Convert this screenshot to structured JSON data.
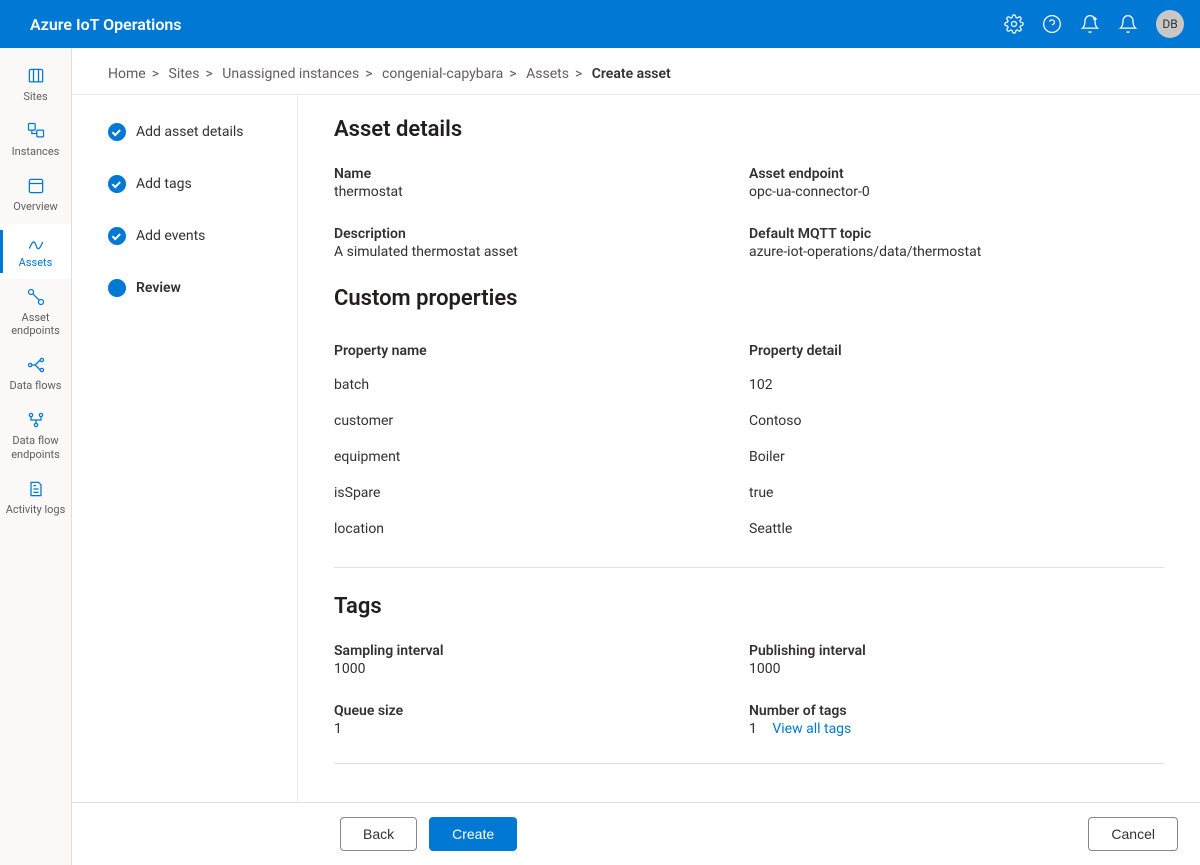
{
  "header": {
    "brand": "Azure IoT Operations",
    "avatar_initials": "DB"
  },
  "sidenav": {
    "items": [
      {
        "label": "Sites"
      },
      {
        "label": "Instances"
      },
      {
        "label": "Overview"
      },
      {
        "label": "Assets"
      },
      {
        "label": "Asset endpoints"
      },
      {
        "label": "Data flows"
      },
      {
        "label": "Data flow endpoints"
      },
      {
        "label": "Activity logs"
      }
    ]
  },
  "breadcrumb": {
    "items": [
      {
        "label": "Home"
      },
      {
        "label": "Sites"
      },
      {
        "label": "Unassigned instances"
      },
      {
        "label": "congenial-capybara"
      },
      {
        "label": "Assets"
      }
    ],
    "current": "Create asset"
  },
  "steps": [
    {
      "label": "Add asset details",
      "done": true
    },
    {
      "label": "Add tags",
      "done": true
    },
    {
      "label": "Add events",
      "done": true
    },
    {
      "label": "Review",
      "current": true
    }
  ],
  "sections": {
    "asset_details": {
      "title": "Asset details",
      "name_label": "Name",
      "name_value": "thermostat",
      "endpoint_label": "Asset endpoint",
      "endpoint_value": "opc-ua-connector-0",
      "description_label": "Description",
      "description_value": "A simulated thermostat asset",
      "mqtt_label": "Default MQTT topic",
      "mqtt_value": "azure-iot-operations/data/thermostat"
    },
    "custom_properties": {
      "title": "Custom properties",
      "header_name": "Property name",
      "header_detail": "Property detail",
      "rows": [
        {
          "name": "batch",
          "detail": "102"
        },
        {
          "name": "customer",
          "detail": "Contoso"
        },
        {
          "name": "equipment",
          "detail": "Boiler"
        },
        {
          "name": "isSpare",
          "detail": "true"
        },
        {
          "name": "location",
          "detail": "Seattle"
        }
      ]
    },
    "tags": {
      "title": "Tags",
      "sampling_label": "Sampling interval",
      "sampling_value": "1000",
      "publishing_label": "Publishing interval",
      "publishing_value": "1000",
      "queue_label": "Queue size",
      "queue_value": "1",
      "numtags_label": "Number of tags",
      "numtags_value": "1",
      "view_all": "View all tags"
    }
  },
  "footer": {
    "back": "Back",
    "create": "Create",
    "cancel": "Cancel"
  }
}
